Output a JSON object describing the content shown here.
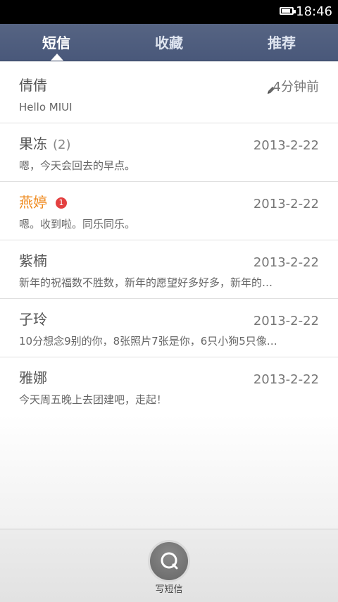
{
  "statusbar": {
    "time": "18:46",
    "battery_level": 0.88
  },
  "tabs": [
    {
      "label": "短信",
      "active": true
    },
    {
      "label": "收藏",
      "active": false
    },
    {
      "label": "推荐",
      "active": false
    }
  ],
  "conversations": [
    {
      "name": "倩倩",
      "count": "",
      "time": "4分钟前",
      "preview": "Hello MIUI",
      "draft": true,
      "unread": false,
      "badge": ""
    },
    {
      "name": "果冻",
      "count": "(2)",
      "time": "2013-2-22",
      "preview": "嗯，今天会回去的早点。",
      "draft": false,
      "unread": false,
      "badge": ""
    },
    {
      "name": "燕婷",
      "count": "",
      "time": "2013-2-22",
      "preview": "嗯。收到啦。同乐同乐。",
      "draft": false,
      "unread": true,
      "badge": "1"
    },
    {
      "name": "紫楠",
      "count": "",
      "time": "2013-2-22",
      "preview": "新年的祝福数不胜数，新年的愿望好多好多，新年的…",
      "draft": false,
      "unread": false,
      "badge": ""
    },
    {
      "name": "子玲",
      "count": "",
      "time": "2013-2-22",
      "preview": "10分想念9别的你，8张照片7张是你，6只小狗5只像…",
      "draft": false,
      "unread": false,
      "badge": ""
    },
    {
      "name": "雅娜",
      "count": "",
      "time": "2013-2-22",
      "preview": "今天周五晚上去团建吧，走起！",
      "draft": false,
      "unread": false,
      "badge": ""
    }
  ],
  "bottom_action": {
    "label": "写短信",
    "icon": "compose-message-icon"
  },
  "colors": {
    "tabbar": "#566483",
    "unread": "#ef8a1e",
    "badge": "#e34040"
  }
}
